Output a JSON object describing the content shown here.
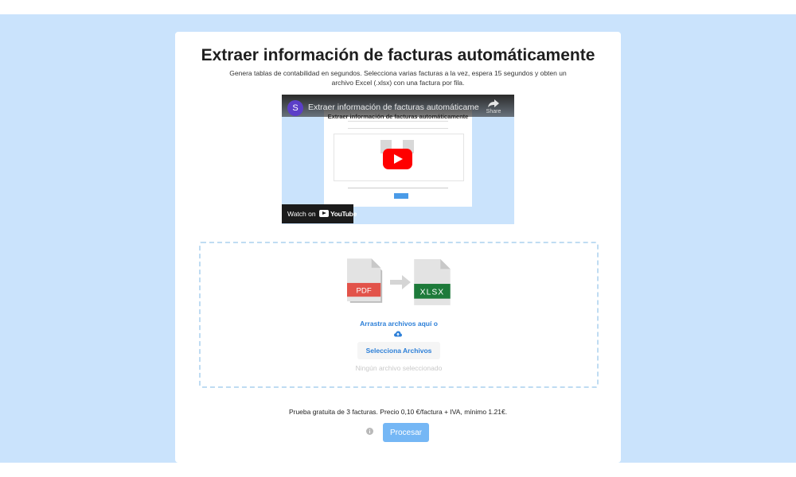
{
  "header": {
    "title": "Extraer información de facturas automáticamente",
    "subtitle": "Genera tablas de contabilidad en segundos. Selecciona varias facturas a la vez, espera 15 segundos y obten un archivo Excel (.xlsx) con una factura por fila."
  },
  "video": {
    "channel_initial": "S",
    "title": "Extraer información de facturas automáticamente",
    "share_label": "Share",
    "inner_page_title": "Extraer información de facturas automáticamente",
    "watch_on_label": "Watch on",
    "youtube_label": "YouTube"
  },
  "dropzone": {
    "pdf_label": "PDF",
    "xlsx_label": "XLSX",
    "drag_text": "Arrastra archivos aquí o",
    "select_button_label": "Selecciona Archivos",
    "no_file_text": "Ningún archivo seleccionado"
  },
  "footer": {
    "trial_text": "Prueba gratuita de 3 facturas. Precio 0,10 €/factura + IVA, mínimo 1.21€.",
    "process_button_label": "Procesar"
  },
  "colors": {
    "page_background": "#cae3fc",
    "accent_blue": "#2c7fd8",
    "process_button": "#75b7f5",
    "pdf_red": "#e2534a",
    "xlsx_green": "#1d7a3a",
    "youtube_red": "#ff0000"
  }
}
